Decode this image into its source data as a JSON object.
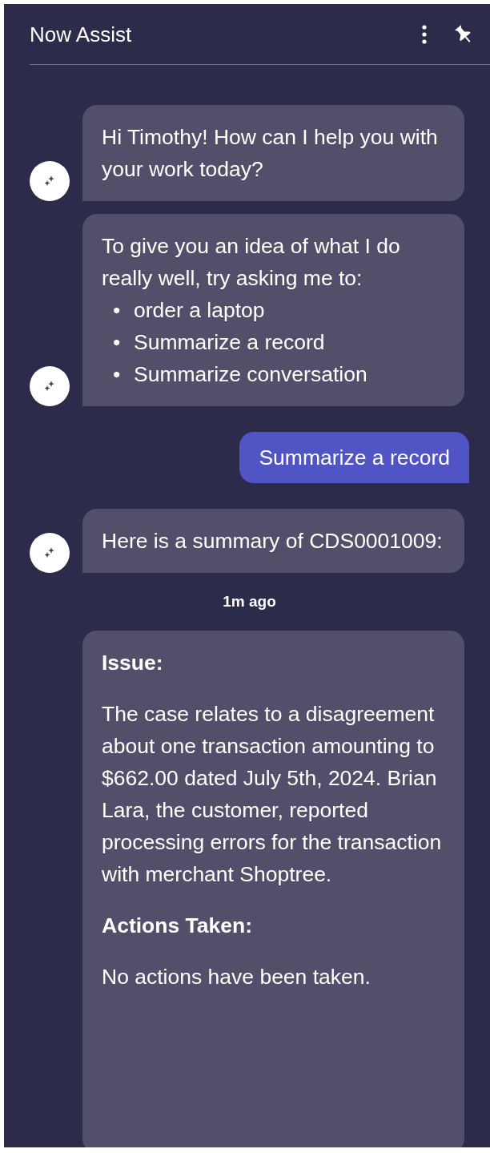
{
  "header": {
    "title": "Now Assist"
  },
  "messages": [
    {
      "kind": "bot",
      "text": "Hi Timothy! How can I help you with your work today?"
    },
    {
      "kind": "bot",
      "text": "To give you an idea of what I do really well, try asking me to:",
      "bullets": [
        {
          "marker": "•",
          "text": "order a laptop"
        },
        {
          "marker": "•",
          "text": "Summarize a record"
        },
        {
          "marker": "•",
          "text": "Summarize conversation"
        }
      ]
    },
    {
      "kind": "user",
      "text": "Summarize a record"
    },
    {
      "kind": "bot",
      "text": "Here is a summary of CDS0001009:"
    },
    {
      "kind": "timestamp",
      "text": "1m ago"
    },
    {
      "kind": "card",
      "sections": [
        {
          "heading": "Issue:",
          "body": "The case relates to a disagreement about one transaction amounting to $662.00 dated July 5th, 2024. Brian Lara, the customer, reported processing errors for the transaction with merchant Shoptree."
        },
        {
          "heading": "Actions Taken:",
          "body": "No actions have been taken."
        }
      ]
    }
  ]
}
